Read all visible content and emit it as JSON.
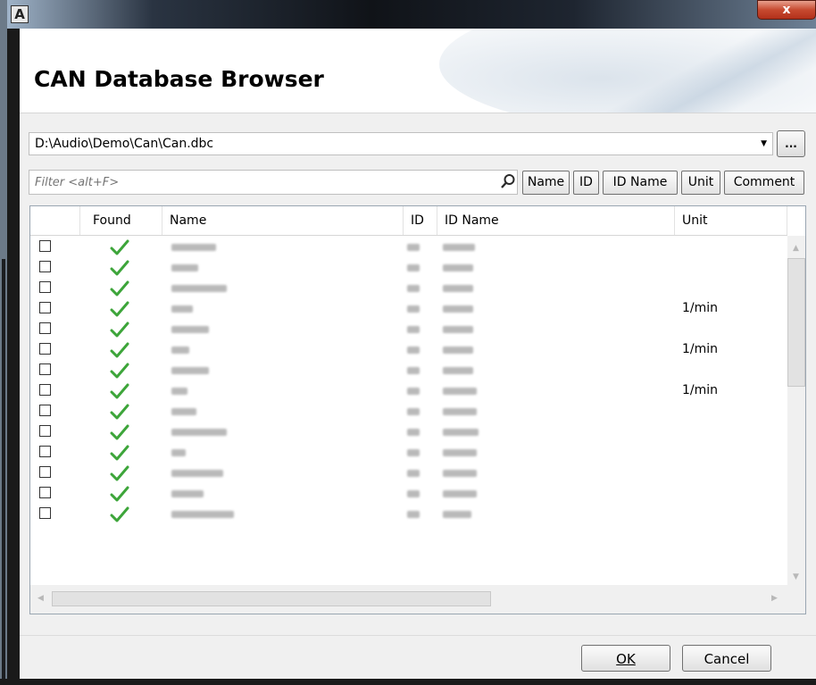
{
  "window": {
    "app_icon_glyph": "A",
    "close_glyph": "x"
  },
  "header": {
    "title": "CAN Database Browser"
  },
  "file_path": {
    "value": "D:\\Audio\\Demo\\Can\\Can.dbc",
    "dropdown_glyph": "▼",
    "browse_label": "..."
  },
  "filter": {
    "placeholder": "Filter <alt+F>",
    "buttons": [
      "Name",
      "ID",
      "ID Name",
      "Unit",
      "Comment"
    ]
  },
  "table": {
    "columns": [
      "Found",
      "Name",
      "ID",
      "ID Name",
      "Unit"
    ],
    "rows": [
      {
        "checked": false,
        "found": true,
        "unit": ""
      },
      {
        "checked": false,
        "found": true,
        "unit": ""
      },
      {
        "checked": false,
        "found": true,
        "unit": ""
      },
      {
        "checked": false,
        "found": true,
        "unit": "1/min"
      },
      {
        "checked": false,
        "found": true,
        "unit": ""
      },
      {
        "checked": false,
        "found": true,
        "unit": "1/min"
      },
      {
        "checked": false,
        "found": true,
        "unit": ""
      },
      {
        "checked": false,
        "found": true,
        "unit": "1/min"
      },
      {
        "checked": false,
        "found": true,
        "unit": ""
      },
      {
        "checked": false,
        "found": true,
        "unit": ""
      },
      {
        "checked": false,
        "found": true,
        "unit": ""
      },
      {
        "checked": false,
        "found": true,
        "unit": ""
      },
      {
        "checked": false,
        "found": true,
        "unit": ""
      },
      {
        "checked": false,
        "found": true,
        "unit": ""
      }
    ]
  },
  "dialog_buttons": {
    "ok": "OK",
    "cancel": "Cancel"
  },
  "colors": {
    "check": "#3da53a",
    "accent_border": "#9aa6b2"
  },
  "icons": {
    "search": "search-icon",
    "check": "check-icon"
  }
}
